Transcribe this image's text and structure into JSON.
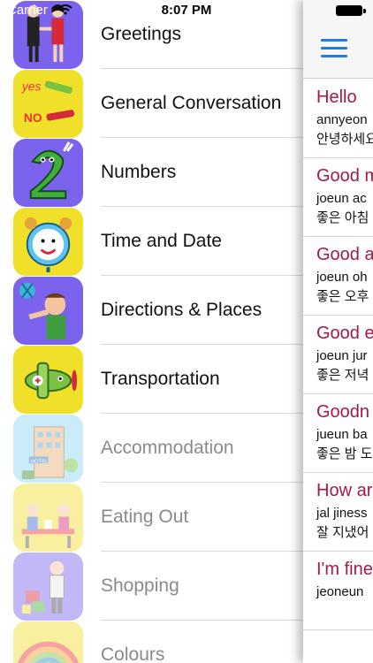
{
  "status_bar": {
    "carrier": "Carrier",
    "time": "8:07 PM"
  },
  "menu": {
    "items": [
      {
        "label": "Greetings",
        "icon": "greeting-people-icon",
        "bg": "#7b63ee"
      },
      {
        "label": "General Conversation",
        "icon": "yes-no-icon",
        "bg": "#f1e02a"
      },
      {
        "label": "Numbers",
        "icon": "number-two-icon",
        "bg": "#7b63ee"
      },
      {
        "label": "Time and Date",
        "icon": "alarm-clock-icon",
        "bg": "#f1e02a"
      },
      {
        "label": "Directions & Places",
        "icon": "pointing-man-icon",
        "bg": "#7b63ee"
      },
      {
        "label": "Transportation",
        "icon": "airplane-icon",
        "bg": "#f1e02a"
      },
      {
        "label": "Accommodation",
        "icon": "hotel-icon",
        "bg": "#8ad6f0"
      },
      {
        "label": "Eating Out",
        "icon": "dining-couple-icon",
        "bg": "#f1e02a"
      },
      {
        "label": "Shopping",
        "icon": "shopping-man-icon",
        "bg": "#7b63ee"
      },
      {
        "label": "Colours",
        "icon": "rainbow-icon",
        "bg": "#f1e02a"
      }
    ]
  },
  "phrases": [
    {
      "english": "Hello",
      "romanized": "annyeon",
      "korean": "안녕하세요"
    },
    {
      "english": "Good m",
      "romanized": "joeun ac",
      "korean": "좋은 아침"
    },
    {
      "english": "Good a",
      "romanized": "joeun oh",
      "korean": "좋은 오후"
    },
    {
      "english": "Good e",
      "romanized": "joeun jur",
      "korean": "좋은 저녁"
    },
    {
      "english": "Goodn",
      "romanized": "jueun ba",
      "korean": "좋은 밤 도"
    },
    {
      "english": "How ar",
      "romanized": "jal jiness",
      "korean": "잘 지냈어"
    },
    {
      "english": "I'm fine",
      "romanized": "jeoneun",
      "korean": ""
    }
  ]
}
